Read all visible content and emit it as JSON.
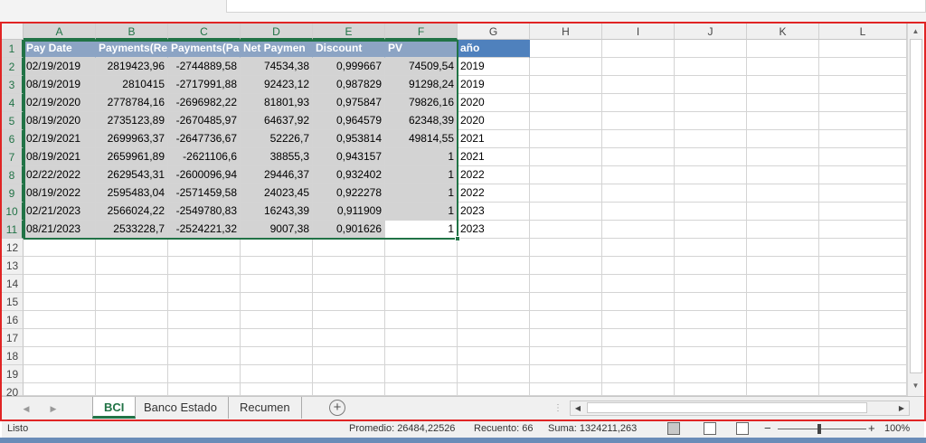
{
  "columns": [
    "A",
    "B",
    "C",
    "D",
    "E",
    "F",
    "G",
    "H",
    "I",
    "J",
    "K",
    "L"
  ],
  "rows": [
    "1",
    "2",
    "3",
    "4",
    "5",
    "6",
    "7",
    "8",
    "9",
    "10",
    "11",
    "12",
    "13",
    "14",
    "15",
    "16",
    "17",
    "18",
    "19",
    "20"
  ],
  "table_header": [
    "Pay Date",
    "Payments(Re",
    "Payments(Pa",
    "Net Paymen",
    "Discount",
    "PV",
    "año"
  ],
  "table_rows": [
    [
      "02/19/2019",
      "2819423,96",
      "-2744889,58",
      "74534,38",
      "0,999667",
      "74509,54",
      "2019"
    ],
    [
      "08/19/2019",
      "2810415",
      "-2717991,88",
      "92423,12",
      "0,987829",
      "91298,24",
      "2019"
    ],
    [
      "02/19/2020",
      "2778784,16",
      "-2696982,22",
      "81801,93",
      "0,975847",
      "79826,16",
      "2020"
    ],
    [
      "08/19/2020",
      "2735123,89",
      "-2670485,97",
      "64637,92",
      "0,964579",
      "62348,39",
      "2020"
    ],
    [
      "02/19/2021",
      "2699963,37",
      "-2647736,67",
      "52226,7",
      "0,953814",
      "49814,55",
      "2021"
    ],
    [
      "08/19/2021",
      "2659961,89",
      "-2621106,6",
      "38855,3",
      "0,943157",
      "1",
      "2021"
    ],
    [
      "02/22/2022",
      "2629543,31",
      "-2600096,94",
      "29446,37",
      "0,932402",
      "1",
      "2022"
    ],
    [
      "08/19/2022",
      "2595483,04",
      "-2571459,58",
      "24023,45",
      "0,922278",
      "1",
      "2022"
    ],
    [
      "02/21/2023",
      "2566024,22",
      "-2549780,83",
      "16243,39",
      "0,911909",
      "1",
      "2023"
    ],
    [
      "08/21/2023",
      "2533228,7",
      "-2524221,32",
      "9007,38",
      "0,901626",
      "1",
      "2023"
    ]
  ],
  "sheets": {
    "tab1": "BCI",
    "tab2": "Banco Estado",
    "tab3": "Recumen"
  },
  "status": {
    "ready": "Listo",
    "average": "Promedio: 26484,22526",
    "count": "Recuento: 66",
    "sum": "Suma: 1324211,263",
    "zoom": "100%"
  },
  "icons": {
    "add_sheet": "plus-circle-icon",
    "nav_prev": "triangle-left-icon",
    "nav_next": "triangle-right-icon",
    "view_normal": "grid-icon",
    "view_layout": "page-layout-icon",
    "view_pagebreak": "page-break-icon"
  },
  "colors": {
    "accent": "#217346",
    "header_fill": "#4f81bd",
    "frame": "#e02424"
  }
}
